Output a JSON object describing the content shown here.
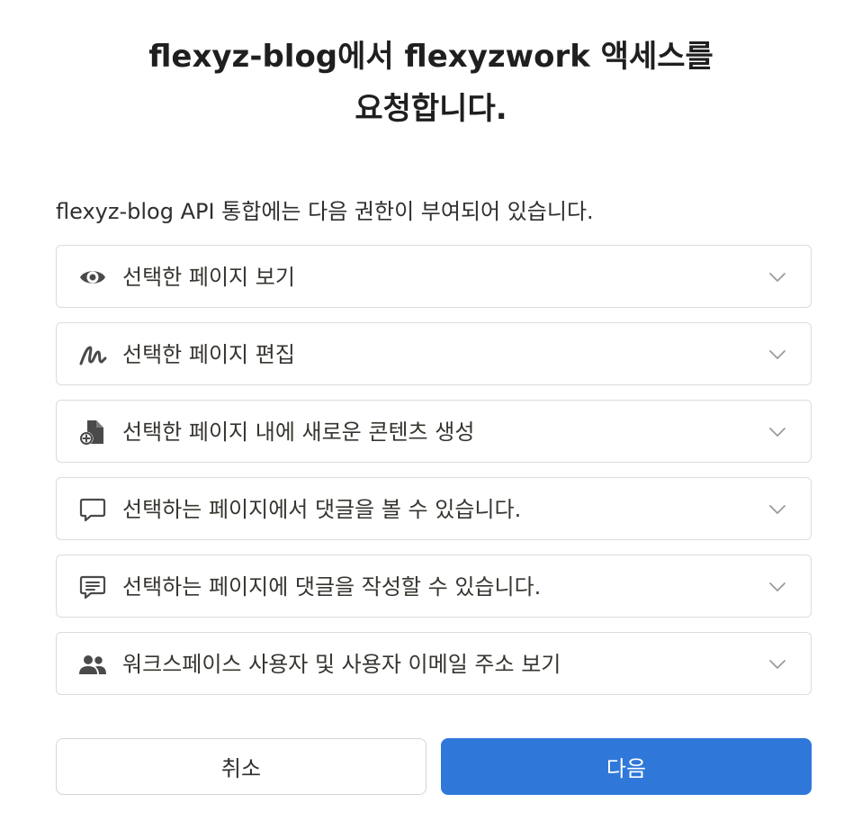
{
  "header": {
    "title_line1": "flexyz-blog에서 flexyzwork 액세스를",
    "title_line2": "요청합니다."
  },
  "intro": "flexyz-blog API 통합에는 다음 권한이 부여되어 있습니다.",
  "permissions": [
    {
      "icon": "eye-icon",
      "label": "선택한 페이지 보기"
    },
    {
      "icon": "signature-pen-icon",
      "label": "선택한 페이지 편집"
    },
    {
      "icon": "add-document-icon",
      "label": "선택한 페이지 내에 새로운 콘텐츠 생성"
    },
    {
      "icon": "comment-icon",
      "label": "선택하는 페이지에서 댓글을 볼 수 있습니다."
    },
    {
      "icon": "comment-lines-icon",
      "label": "선택하는 페이지에 댓글을 작성할 수 있습니다."
    },
    {
      "icon": "people-icon",
      "label": "워크스페이스 사용자 및 사용자 이메일 주소 보기"
    }
  ],
  "buttons": {
    "cancel": "취소",
    "next": "다음"
  },
  "colors": {
    "primary": "#2f78da",
    "border": "#dcdcdc",
    "icon": "#4a4a4a"
  }
}
